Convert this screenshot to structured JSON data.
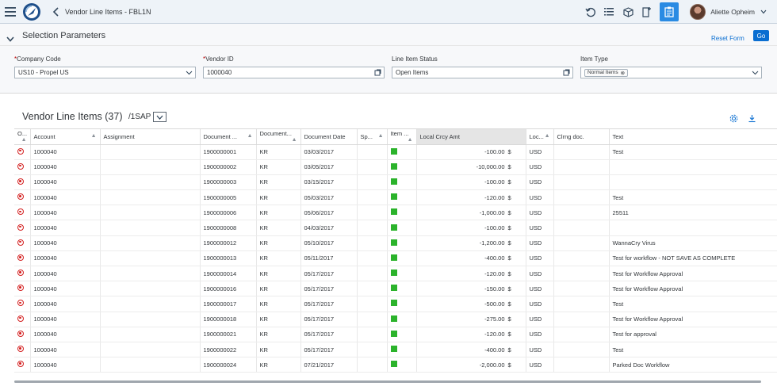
{
  "shell": {
    "title": "Vendor Line Items - FBL1N",
    "user": "Aliette Opheim"
  },
  "selection": {
    "title": "Selection Parameters",
    "reset_label": "Reset Form",
    "go_label": "Go",
    "company_code": {
      "label": "Company Code",
      "value": "US10 - Propel US"
    },
    "vendor_id": {
      "label": "Vendor ID",
      "value": "1000040"
    },
    "status": {
      "label": "Line Item Status",
      "value": "Open Items"
    },
    "item_type": {
      "label": "Item Type",
      "token": "Normal Items"
    }
  },
  "table": {
    "title": "Vendor Line Items",
    "count": "(37)",
    "variant": "/1SAP",
    "columns": [
      "O...",
      "Account",
      "Assignment",
      "Document ...",
      "Document...",
      "Document Date",
      "Sp...",
      "Item ...",
      "Local Crcy Amt",
      "Loc...",
      "Clrng doc.",
      "Text"
    ],
    "rows": [
      {
        "account": "1000040",
        "doc": "1900000001",
        "type": "KR",
        "date": "03/03/2017",
        "amt": "-100.00",
        "cur": "$",
        "loc": "USD",
        "text": "Test"
      },
      {
        "account": "1000040",
        "doc": "1900000002",
        "type": "KR",
        "date": "03/05/2017",
        "amt": "-10,000.00",
        "cur": "$",
        "loc": "USD",
        "text": ""
      },
      {
        "account": "1000040",
        "doc": "1900000003",
        "type": "KR",
        "date": "03/15/2017",
        "amt": "-100.00",
        "cur": "$",
        "loc": "USD",
        "text": ""
      },
      {
        "account": "1000040",
        "doc": "1900000005",
        "type": "KR",
        "date": "05/03/2017",
        "amt": "-120.00",
        "cur": "$",
        "loc": "USD",
        "text": "Test"
      },
      {
        "account": "1000040",
        "doc": "1900000006",
        "type": "KR",
        "date": "05/06/2017",
        "amt": "-1,000.00",
        "cur": "$",
        "loc": "USD",
        "text": "25511"
      },
      {
        "account": "1000040",
        "doc": "1900000008",
        "type": "KR",
        "date": "04/03/2017",
        "amt": "-100.00",
        "cur": "$",
        "loc": "USD",
        "text": ""
      },
      {
        "account": "1000040",
        "doc": "1900000012",
        "type": "KR",
        "date": "05/10/2017",
        "amt": "-1,200.00",
        "cur": "$",
        "loc": "USD",
        "text": "WannaCry Virus"
      },
      {
        "account": "1000040",
        "doc": "1900000013",
        "type": "KR",
        "date": "05/11/2017",
        "amt": "-400.00",
        "cur": "$",
        "loc": "USD",
        "text": "Test for workflow - NOT SAVE AS COMPLETE"
      },
      {
        "account": "1000040",
        "doc": "1900000014",
        "type": "KR",
        "date": "05/17/2017",
        "amt": "-120.00",
        "cur": "$",
        "loc": "USD",
        "text": "Test for Workflow Approval"
      },
      {
        "account": "1000040",
        "doc": "1900000016",
        "type": "KR",
        "date": "05/17/2017",
        "amt": "-150.00",
        "cur": "$",
        "loc": "USD",
        "text": "Test for Workflow Approval"
      },
      {
        "account": "1000040",
        "doc": "1900000017",
        "type": "KR",
        "date": "05/17/2017",
        "amt": "-500.00",
        "cur": "$",
        "loc": "USD",
        "text": "Test"
      },
      {
        "account": "1000040",
        "doc": "1900000018",
        "type": "KR",
        "date": "05/17/2017",
        "amt": "-275.00",
        "cur": "$",
        "loc": "USD",
        "text": "Test for Workflow Approval"
      },
      {
        "account": "1000040",
        "doc": "1900000021",
        "type": "KR",
        "date": "05/17/2017",
        "amt": "-120.00",
        "cur": "$",
        "loc": "USD",
        "text": "Test for approval"
      },
      {
        "account": "1000040",
        "doc": "1900000022",
        "type": "KR",
        "date": "05/17/2017",
        "amt": "-400.00",
        "cur": "$",
        "loc": "USD",
        "text": "Test"
      },
      {
        "account": "1000040",
        "doc": "1900000024",
        "type": "KR",
        "date": "07/21/2017",
        "amt": "-2,000.00",
        "cur": "$",
        "loc": "USD",
        "text": "Parked Doc Workflow"
      }
    ]
  },
  "colors": {
    "accent": "#0a6ed1",
    "status_open": "#d42020",
    "item_ok": "#2bb32b"
  }
}
